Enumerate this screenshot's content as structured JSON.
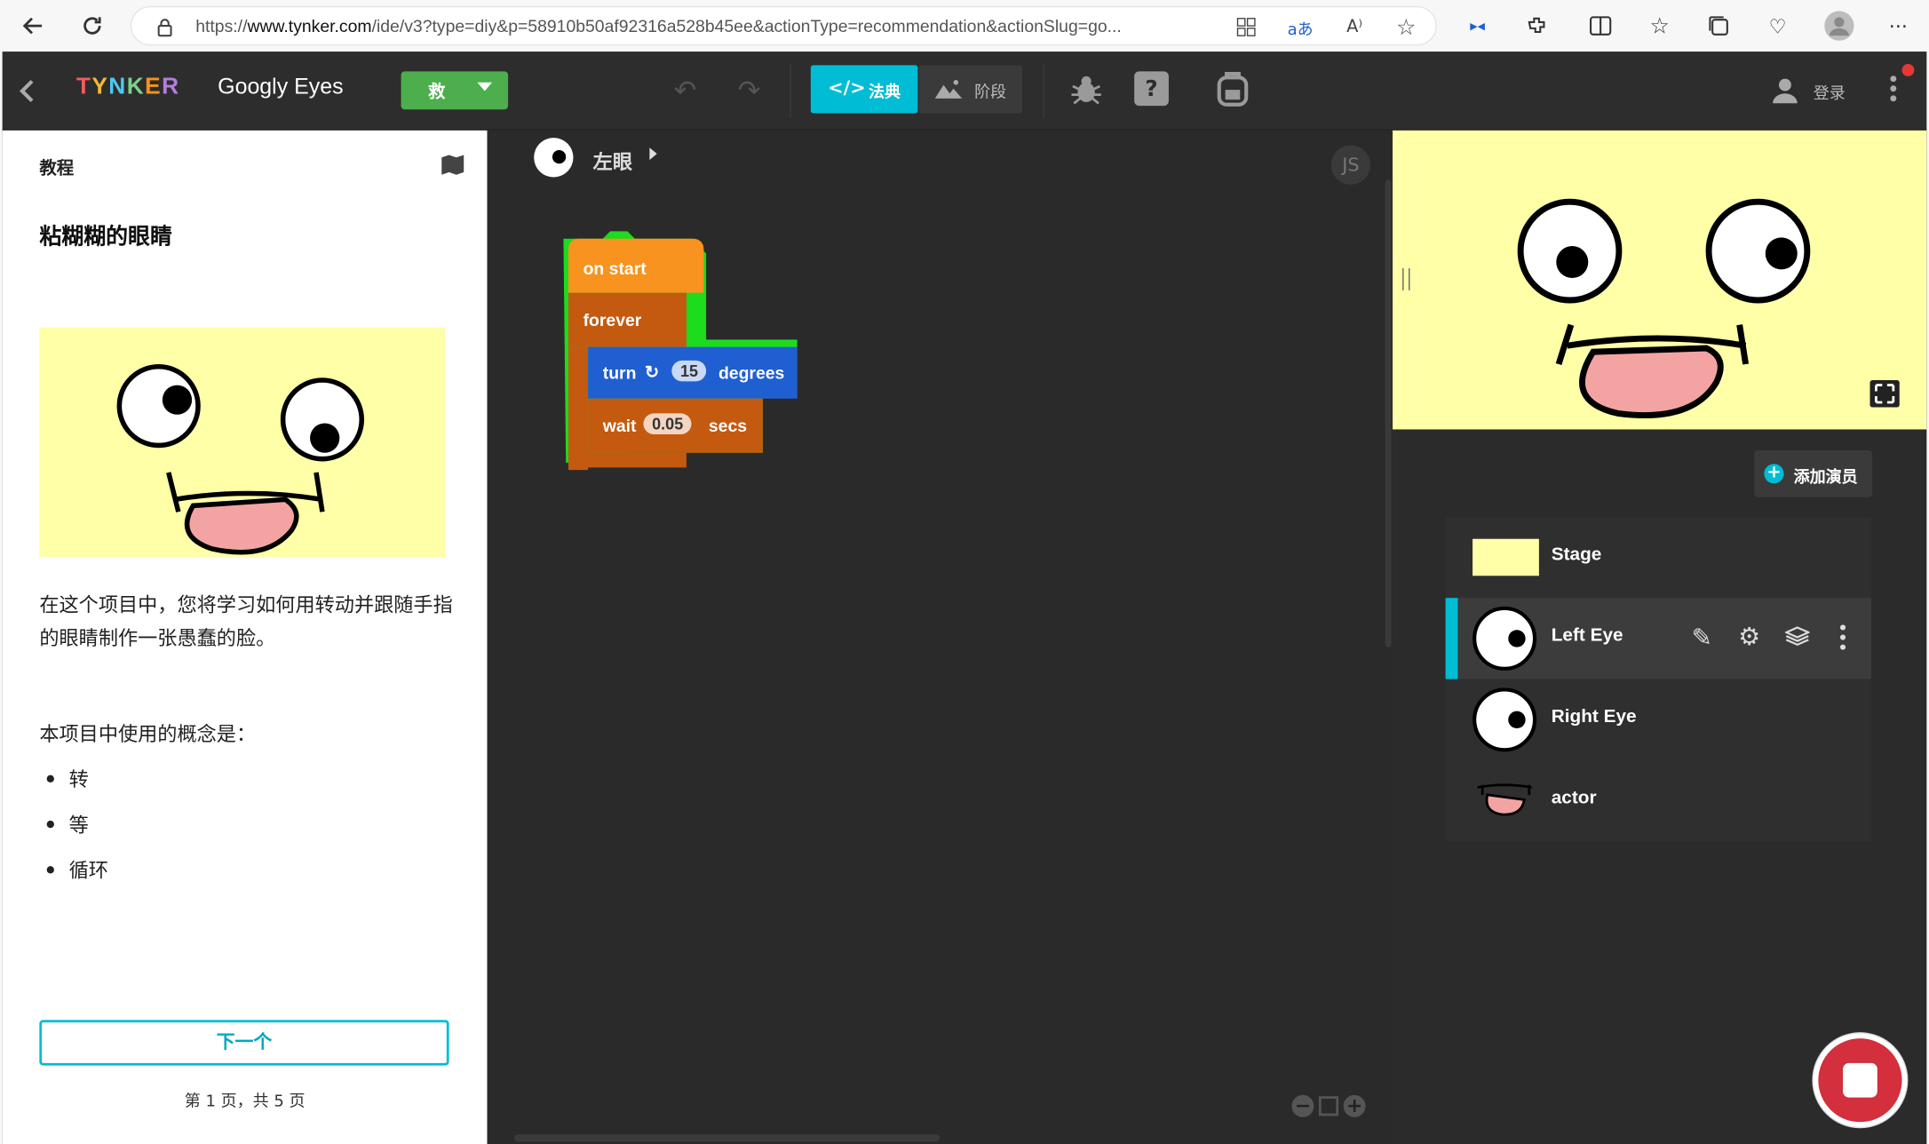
{
  "browser": {
    "url_prefix": "https://",
    "url_domain": "www.tynker.com",
    "url_rest": "/ide/v3?type=diy&p=58910b50af92316a528b45ee&actionType=recommendation&actionSlug=go..."
  },
  "toolbar": {
    "logo": "TYNKER",
    "project_title": "Googly Eyes",
    "save_label": "救",
    "code_tab": "法典",
    "stage_tab": "阶段",
    "login": "登录"
  },
  "tutorial": {
    "header": "教程",
    "title": "粘糊糊的眼睛",
    "description": "在这个项目中，您将学习如何用转动并跟随手指的眼睛制作一张愚蠢的脸。",
    "concepts_heading": "本项目中使用的概念是：",
    "concepts": [
      "转",
      "等",
      "循环"
    ],
    "next_button": "下一个",
    "pagination": "第 1 页，共 5 页"
  },
  "code": {
    "actor_name": "左眼",
    "js_label": "JS",
    "blocks": {
      "on_start": "on start",
      "forever": "forever",
      "turn": "turn",
      "turn_value": "15",
      "degrees": "degrees",
      "wait": "wait",
      "wait_value": "0.05",
      "secs": "secs"
    }
  },
  "actors": {
    "add_actor": "添加演员",
    "list": [
      {
        "name": "Stage"
      },
      {
        "name": "Left Eye"
      },
      {
        "name": "Right Eye"
      },
      {
        "name": "actor"
      }
    ]
  },
  "colors": {
    "accent": "#00bcd4",
    "save_green": "#4cae4c",
    "event_orange": "#f7931e",
    "control_brown": "#c45a10",
    "motion_blue": "#1f5fd1",
    "highlight": "#1ddb1d",
    "stage_yellow": "#ffffa8"
  }
}
